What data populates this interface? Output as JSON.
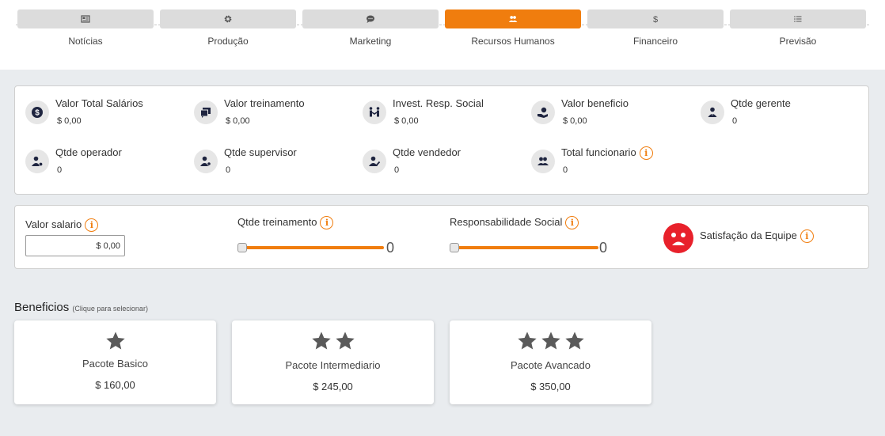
{
  "nav": {
    "tabs": [
      {
        "label": "Notícias",
        "icon": "newspaper-icon"
      },
      {
        "label": "Produção",
        "icon": "gear-icon"
      },
      {
        "label": "Marketing",
        "icon": "chat-icon"
      },
      {
        "label": "Recursos Humanos",
        "icon": "users-icon",
        "active": true
      },
      {
        "label": "Financeiro",
        "icon": "dollar-icon"
      },
      {
        "label": "Previsão",
        "icon": "list-icon"
      }
    ],
    "active_color": "#f07d0e"
  },
  "stats": [
    {
      "title": "Valor Total Salários",
      "value": "$ 0,00",
      "icon": "dollar-circle-icon"
    },
    {
      "title": "Valor treinamento",
      "value": "$ 0,00",
      "icon": "training-icon"
    },
    {
      "title": "Invest. Resp. Social",
      "value": "$ 0,00",
      "icon": "handshake-icon"
    },
    {
      "title": "Valor beneficio",
      "value": "$ 0,00",
      "icon": "hand-money-icon"
    },
    {
      "title": "Qtde gerente",
      "value": "0",
      "icon": "manager-icon"
    },
    {
      "title": "Qtde operador",
      "value": "0",
      "icon": "operator-icon"
    },
    {
      "title": "Qtde supervisor",
      "value": "0",
      "icon": "supervisor-icon"
    },
    {
      "title": "Qtde vendedor",
      "value": "0",
      "icon": "seller-icon"
    },
    {
      "title": "Total funcionario",
      "value": "0",
      "icon": "group-icon"
    }
  ],
  "controls": {
    "salary_label": "Valor salario",
    "salary_value": "$ 0,00",
    "training_label": "Qtde treinamento",
    "training_value": "0",
    "social_label": "Responsabilidade Social",
    "social_value": "0",
    "satisfaction_label": "Satisfação da Equipe",
    "satisfaction_mood": "sad",
    "satisfaction_color": "#e8212b"
  },
  "benefits": {
    "title": "Beneficios",
    "hint": "(Clique para selecionar)",
    "packages": [
      {
        "name": "Pacote Basico",
        "price": "$ 160,00",
        "stars": 1
      },
      {
        "name": "Pacote Intermediario",
        "price": "$ 245,00",
        "stars": 2
      },
      {
        "name": "Pacote Avancado",
        "price": "$ 350,00",
        "stars": 3
      }
    ]
  }
}
